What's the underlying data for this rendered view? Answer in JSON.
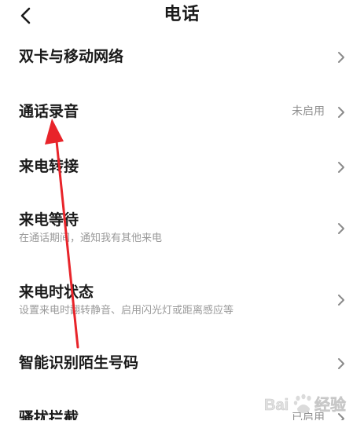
{
  "header": {
    "back_icon": "chevron-left-icon",
    "title": "电话"
  },
  "rows": [
    {
      "title": "双卡与移动网络",
      "subtitle": "",
      "value": ""
    },
    {
      "title": "通话录音",
      "subtitle": "",
      "value": "未启用"
    },
    {
      "title": "来电转接",
      "subtitle": "",
      "value": ""
    },
    {
      "title": "来电等待",
      "subtitle": "在通话期间，通知我有其他来电",
      "value": ""
    },
    {
      "title": "来电时状态",
      "subtitle": "设置来电时翻转静音、启用闪光灯或距离感应等",
      "value": ""
    },
    {
      "title": "智能识别陌生号码",
      "subtitle": "",
      "value": ""
    },
    {
      "title": "骚扰拦截",
      "subtitle": "",
      "value": "已启用"
    }
  ],
  "annotation": {
    "arrow_color": "#e8242a"
  },
  "watermark": {
    "text": "Baidu经验"
  }
}
